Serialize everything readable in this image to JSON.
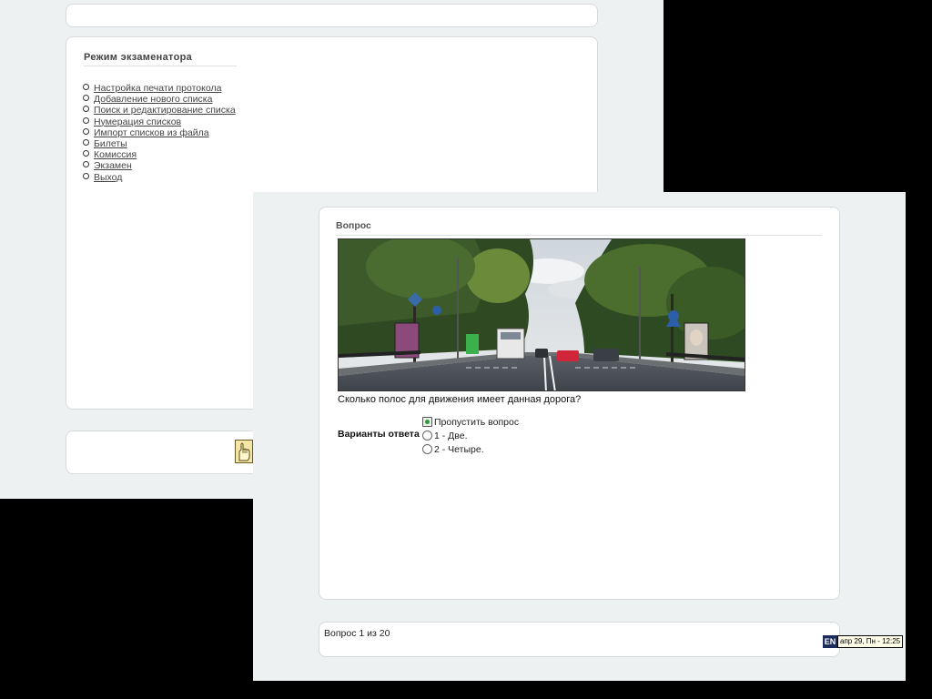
{
  "back_window": {
    "heading": "Режим экзаменатора",
    "menu": [
      "Настройка печати протокола",
      "Добавление нового списка",
      "Поиск и редактирование списка",
      "Нумерация списков",
      "Импорт списков из файла",
      "Билеты",
      "Комиссия",
      "Экзамен",
      "Выход"
    ],
    "help_icon": "hand-pointer-icon"
  },
  "question": {
    "heading": "Вопрос",
    "image_icon": "road-photo",
    "text": "Сколько полос для движения имеет данная дорога?",
    "answers_label": "Варианты ответа",
    "answers": [
      {
        "label": "Пропустить вопрос",
        "selected": true
      },
      {
        "label": "1 - Две.",
        "selected": false
      },
      {
        "label": "2 - Четыре.",
        "selected": false
      }
    ]
  },
  "status": {
    "progress": "Вопрос 1 из 20"
  },
  "tray": {
    "language": "EN",
    "clock": "апр 29, Пн - 12:25"
  },
  "colors": {
    "window_bg": "#eef1f2",
    "panel_bg": "#ffffff",
    "desktop_bg": "#000000",
    "selected_radio": "#2d9a3d"
  }
}
